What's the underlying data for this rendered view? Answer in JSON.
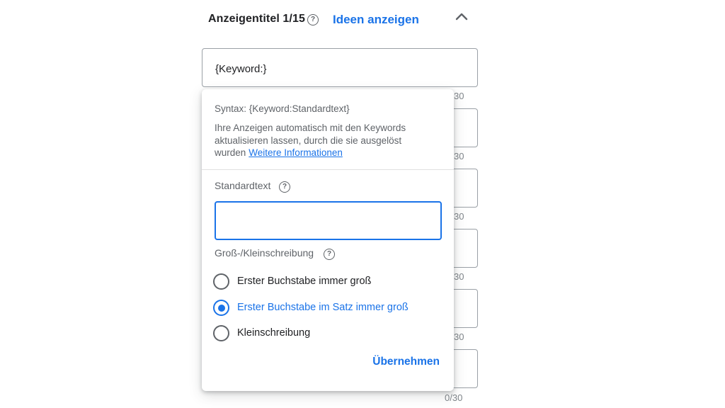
{
  "header": {
    "title": "Anzeigentitel 1/15",
    "help_icon": "question-circle-icon",
    "ideas_link": "Ideen anzeigen",
    "collapse_icon": "chevron-up-icon"
  },
  "headlines": {
    "first_value": "{Keyword:}",
    "counters": [
      "30",
      "30",
      "30",
      "30",
      "30",
      "0/30"
    ]
  },
  "popup": {
    "syntax": "Syntax: {Keyword:Standardtext}",
    "description": "Ihre Anzeigen automatisch mit den Keywords aktualisieren lassen, durch die sie ausgelöst wurden",
    "more_link": "Weitere Informationen",
    "default_text_label": "Standardtext",
    "default_text_value": "",
    "case_label": "Groß-/Kleinschreibung",
    "options": [
      {
        "label": "Erster Buchstabe immer groß",
        "selected": false
      },
      {
        "label": "Erster Buchstabe im Satz immer groß",
        "selected": true
      },
      {
        "label": "Kleinschreibung",
        "selected": false
      }
    ],
    "apply_button": "Übernehmen"
  },
  "colors": {
    "accent": "#1a73e8",
    "text_primary": "#202124",
    "text_secondary": "#5f6368",
    "border": "#9aa0a6"
  }
}
